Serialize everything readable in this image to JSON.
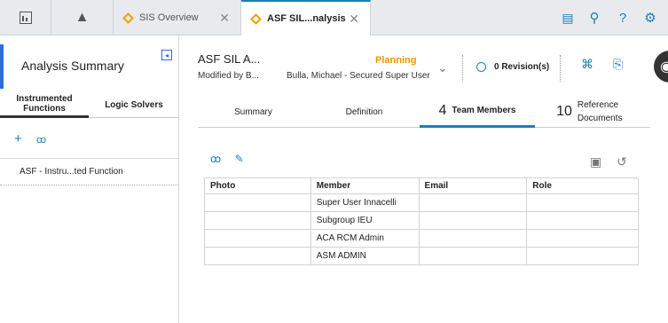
{
  "topbar": {
    "tabs": [
      {
        "label": "SIS Overview",
        "active": false
      },
      {
        "label": "ASF SIL...nalysis",
        "active": true
      }
    ],
    "close_glyph": "✕",
    "icons": [
      "dashboard-icon",
      "pyramid-icon",
      "report-icon",
      "search-icon",
      "help-icon",
      "settings-icon"
    ]
  },
  "sidebar": {
    "title": "Analysis Summary",
    "tabs": [
      {
        "label": "Instrumented Functions",
        "active": true
      },
      {
        "label": "Logic Solvers",
        "active": false
      }
    ],
    "items": [
      {
        "label": "ASF - Instru...ted Function"
      }
    ]
  },
  "header": {
    "title": "ASF SIL A...",
    "modified": "Modified by B...",
    "state": "Planning",
    "user": "Bulla, Michael - Secured Super User",
    "revisions": "0 Revision(s)"
  },
  "tabs": [
    {
      "num": "",
      "label": "Summary",
      "active": false
    },
    {
      "num": "",
      "label": "Definition",
      "active": false
    },
    {
      "num": "4",
      "label": "Team Members",
      "active": true
    },
    {
      "num": "10",
      "label": "Reference Documents",
      "active": false
    }
  ],
  "table": {
    "columns": [
      "Photo",
      "Member",
      "Email",
      "Role"
    ],
    "rows": [
      [
        "",
        "Super User Innacelli",
        "",
        ""
      ],
      [
        "",
        "Subgroup IEU",
        "",
        ""
      ],
      [
        "",
        "ACA RCM Admin",
        "",
        ""
      ],
      [
        "",
        "ASM ADMIN",
        "",
        ""
      ]
    ]
  },
  "colors": {
    "accent": "#1a7fb7",
    "state": "#f39400",
    "sidebar_marker": "#2a6fd6"
  }
}
